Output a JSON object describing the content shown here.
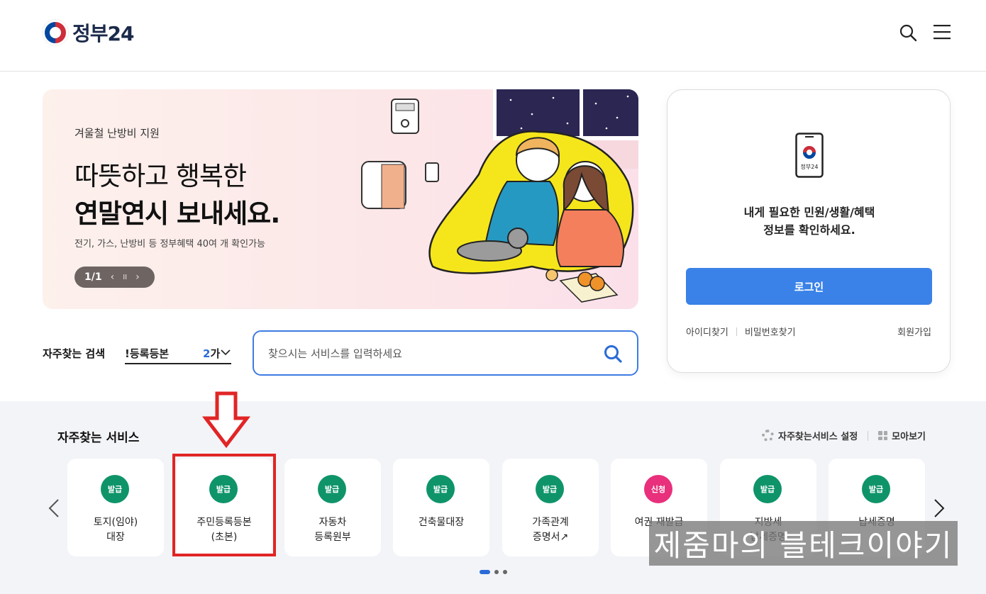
{
  "header": {
    "logo_text": "정부24",
    "search_icon": "search-icon",
    "menu_icon": "hamburger-menu-icon"
  },
  "banner": {
    "eyebrow": "겨울철 난방비 지원",
    "title_line1": "따뜻하고 행복한",
    "title_line2": "연말연시 보내세요.",
    "description": "전기, 가스, 난방비 등 정부혜택 40여 개 확인가능",
    "pager": "1/1",
    "prev": "‹",
    "pause": "II",
    "next": "›"
  },
  "fav_search": {
    "label": "자주찾는 검색",
    "keyword": "!등록등본",
    "rank_num": "2",
    "rank_rest": "가",
    "placeholder": "찾으시는 서비스를 입력하세요"
  },
  "login": {
    "message_line1": "내게 필요한 민원/생활/혜택",
    "message_line2": "정보를 확인하세요.",
    "phone_label": "정부24",
    "button": "로그인",
    "find_id": "아이디찾기",
    "find_pw": "비밀번호찾기",
    "signup": "회원가입"
  },
  "services": {
    "title": "자주찾는 서비스",
    "settings": "자주찾는서비스 설정",
    "view_all": "모아보기",
    "items": [
      {
        "badge": "발급",
        "name": "토지(임야)\n대장",
        "color": "#0f9469"
      },
      {
        "badge": "발급",
        "name": "주민등록등본\n(초본)",
        "color": "#0f9469"
      },
      {
        "badge": "발급",
        "name": "자동차\n등록원부",
        "color": "#0f9469"
      },
      {
        "badge": "발급",
        "name": "건축물대장",
        "color": "#0f9469"
      },
      {
        "badge": "발급",
        "name": "가족관계\n증명서↗",
        "color": "#0f9469"
      },
      {
        "badge": "신청",
        "name": "여권 재발급",
        "color": "#e8307c"
      },
      {
        "badge": "발급",
        "name": "지방세\n납세증명",
        "color": "#0f9469"
      },
      {
        "badge": "발급",
        "name": "납세증명",
        "color": "#0f9469"
      }
    ]
  },
  "watermark": "제줌마의 블테크이야기",
  "colors": {
    "primary_blue": "#3a82e8",
    "issue_green": "#0f9469",
    "apply_pink": "#e8307c",
    "highlight_red": "#e12525"
  }
}
